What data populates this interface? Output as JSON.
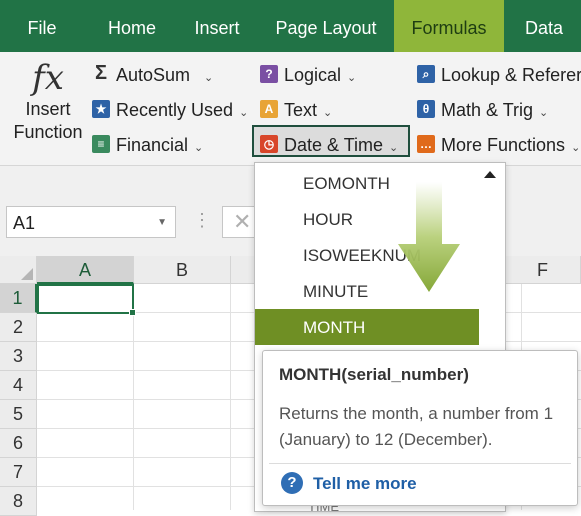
{
  "tabs": [
    {
      "label": "File"
    },
    {
      "label": "Home"
    },
    {
      "label": "Insert"
    },
    {
      "label": "Page Layout"
    },
    {
      "label": "Formulas",
      "active": true
    },
    {
      "label": "Data"
    }
  ],
  "ribbon": {
    "insert_function": {
      "glyph": "fx",
      "line1": "Insert",
      "line2": "Function"
    },
    "autosum": "AutoSum",
    "recently_used": "Recently Used",
    "financial": "Financial",
    "logical": "Logical",
    "text": "Text",
    "date_time": "Date & Time",
    "lookup": "Lookup & Referer",
    "math_trig": "Math & Trig",
    "more_functions": "More Functions"
  },
  "formula_bar": {
    "name_box": "A1",
    "cancel_glyph": "✕"
  },
  "grid": {
    "columns": [
      "A",
      "B",
      "F"
    ],
    "rows": [
      "1",
      "2",
      "3",
      "4",
      "5",
      "6",
      "7",
      "8"
    ],
    "active_cell": "A1"
  },
  "dropdown": {
    "items": [
      "EOMONTH",
      "HOUR",
      "ISOWEEKNUM",
      "MINUTE",
      "MONTH"
    ],
    "highlighted": "MONTH",
    "partial_item": "TIME"
  },
  "tooltip": {
    "title": "MONTH(serial_number)",
    "description": "Returns the month, a number from 1 (January) to 12 (December).",
    "link": "Tell me more"
  },
  "colors": {
    "ribbon_green": "#217346",
    "active_tab": "#8fb63a",
    "highlight": "#6f8f24",
    "link": "#1f5fa6"
  }
}
